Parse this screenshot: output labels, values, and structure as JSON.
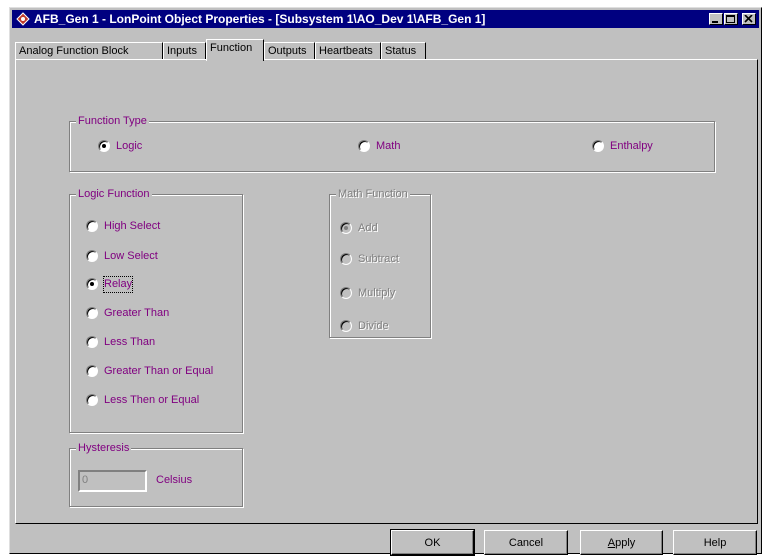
{
  "window": {
    "title": "AFB_Gen 1 - LonPoint Object Properties - [Subsystem 1\\AO_Dev 1\\AFB_Gen 1]"
  },
  "tabs": [
    {
      "label": "Analog Function Block",
      "active": false
    },
    {
      "label": "Inputs",
      "active": false
    },
    {
      "label": "Function",
      "active": true
    },
    {
      "label": "Outputs",
      "active": false
    },
    {
      "label": "Heartbeats",
      "active": false
    },
    {
      "label": "Status",
      "active": false
    }
  ],
  "function_type": {
    "legend": "Function Type",
    "options": [
      {
        "label": "Logic",
        "selected": true
      },
      {
        "label": "Math",
        "selected": false
      },
      {
        "label": "Enthalpy",
        "selected": false
      }
    ]
  },
  "logic_function": {
    "legend": "Logic Function",
    "options": [
      {
        "label": "High Select",
        "selected": false
      },
      {
        "label": "Low Select",
        "selected": false
      },
      {
        "label": "Relay",
        "selected": true
      },
      {
        "label": "Greater Than",
        "selected": false
      },
      {
        "label": "Less Than",
        "selected": false
      },
      {
        "label": "Greater Than or Equal",
        "selected": false
      },
      {
        "label": "Less Then or Equal",
        "selected": false
      }
    ]
  },
  "math_function": {
    "legend": "Math Function",
    "enabled": false,
    "options": [
      {
        "label": "Add",
        "selected": true
      },
      {
        "label": "Subtract",
        "selected": false
      },
      {
        "label": "Multiply",
        "selected": false
      },
      {
        "label": "Divide",
        "selected": false
      }
    ]
  },
  "hysteresis": {
    "legend": "Hysteresis",
    "value": "0",
    "unit": "Celsius"
  },
  "buttons": {
    "ok": "OK",
    "cancel": "Cancel",
    "apply_underlined": "A",
    "apply_rest": "pply",
    "help": "Help"
  },
  "colors": {
    "title_bar": "#000080",
    "face": "#c0c0c0",
    "label": "#800080",
    "disabled": "#808080"
  }
}
